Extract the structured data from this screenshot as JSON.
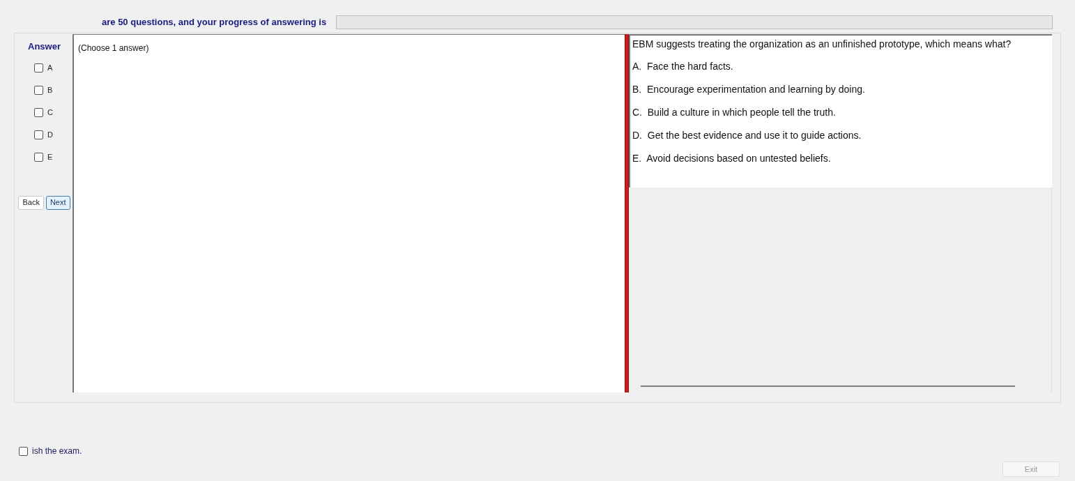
{
  "header": {
    "text": "are 50 questions, and your progress of answering is",
    "progress": {
      "level": 0
    }
  },
  "answer_panel": {
    "title": "Answer",
    "options": [
      {
        "label": "A",
        "checked": false
      },
      {
        "label": "B",
        "checked": false
      },
      {
        "label": "C",
        "checked": false
      },
      {
        "label": "D",
        "checked": false
      },
      {
        "label": "E",
        "checked": false
      }
    ],
    "buttons": [
      {
        "label": "Back",
        "selected": false
      },
      {
        "label": "Next",
        "selected": true
      }
    ]
  },
  "instruction": "(Choose 1 answer)",
  "question": {
    "text": "EBM suggests treating the organization as an unfinished prototype, which means what?",
    "choices": [
      "A.  Face the hard facts.",
      "B.  Encourage experimentation and learning by doing.",
      "C.  Build a culture in which people tell the truth.",
      "D.  Get the best evidence and use it to guide actions.",
      "E.  Avoid decisions based on untested beliefs."
    ]
  },
  "finish": {
    "label": "ish the exam.",
    "checked": false
  },
  "exit_button": {
    "label": "Exit",
    "disabled": true
  }
}
